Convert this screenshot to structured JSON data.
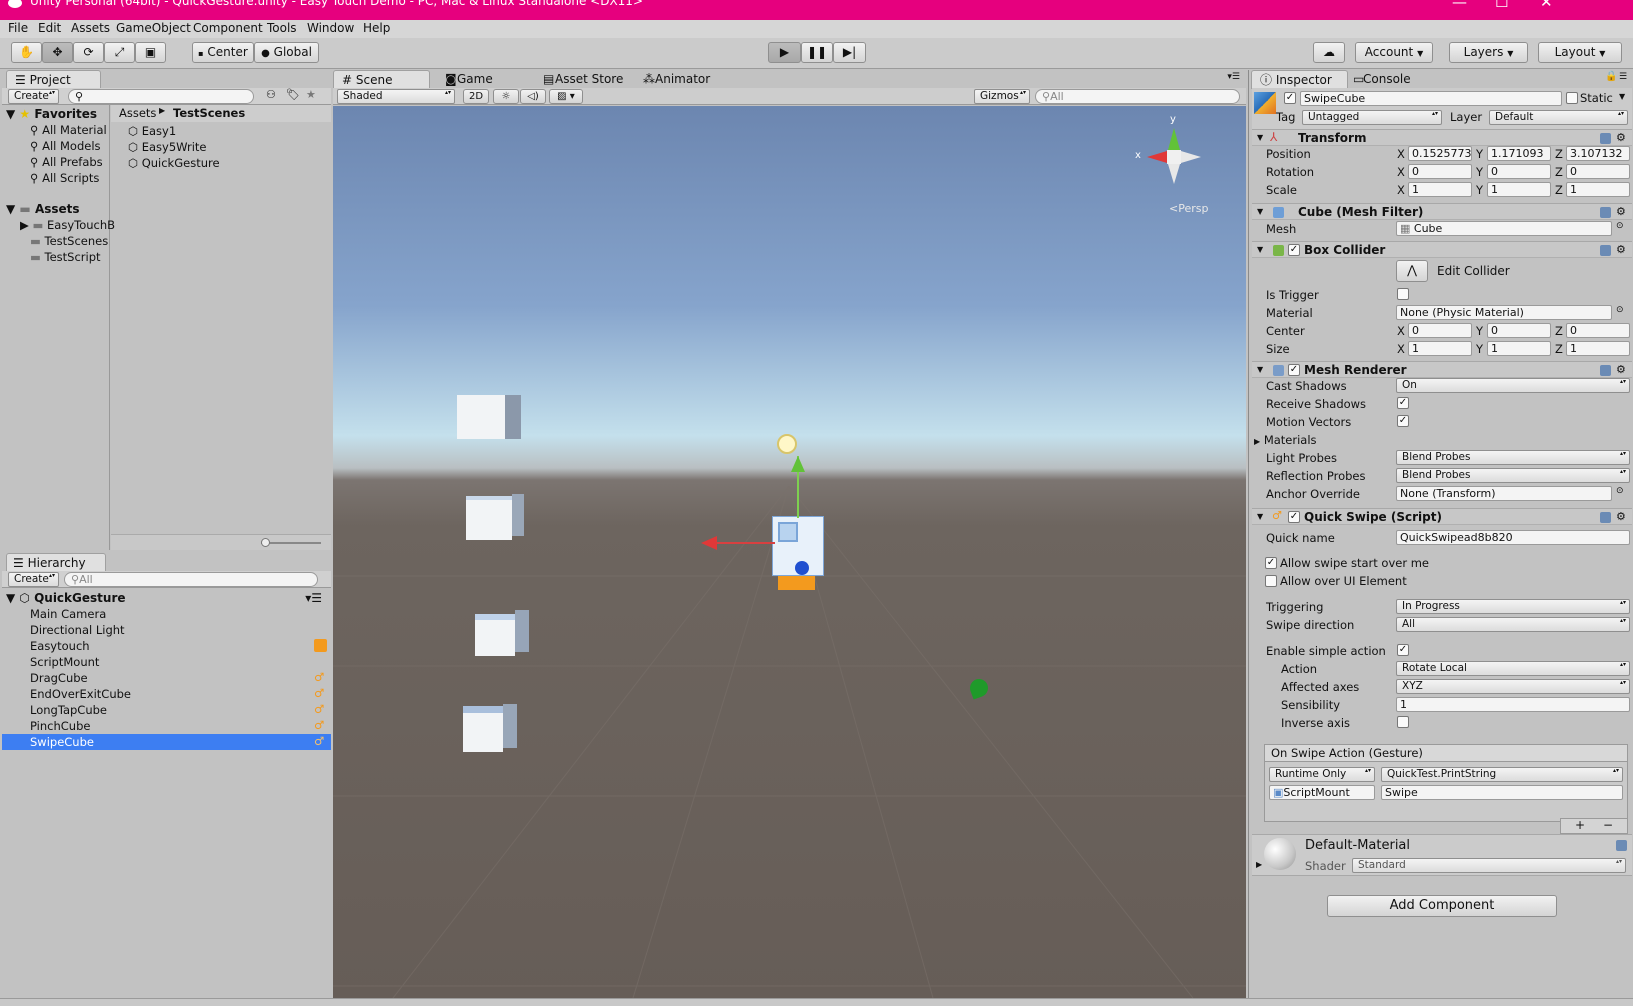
{
  "window": {
    "title": "Unity Personal (64bit) - QuickGesture.unity - Easy Touch Demo - PC, Mac & Linux Standalone <DX11>",
    "minimize": "—",
    "maximize": "☐",
    "close": "✕"
  },
  "menu": [
    "File",
    "Edit",
    "Assets",
    "GameObject",
    "Component",
    "Tools",
    "Window",
    "Help"
  ],
  "toolbar": {
    "pivot": "Center",
    "space": "Global",
    "account": "Account",
    "layers": "Layers",
    "layout": "Layout"
  },
  "project": {
    "tab": "Project",
    "create": "Create",
    "favorites": {
      "label": "Favorites",
      "items": [
        "All Material",
        "All Models",
        "All Prefabs",
        "All Scripts"
      ]
    },
    "assets": {
      "label": "Assets",
      "items": [
        "EasyTouchB",
        "TestScenes",
        "TestScript"
      ]
    },
    "breadcrumb": [
      "Assets",
      "TestScenes"
    ],
    "files": [
      "Easy1",
      "Easy5Write",
      "QuickGesture"
    ]
  },
  "hierarchy": {
    "tab": "Hierarchy",
    "create": "Create",
    "search_placeholder": "All",
    "scene": "QuickGesture",
    "items": [
      "Main Camera",
      "Directional Light",
      "Easytouch",
      "ScriptMount",
      "DragCube",
      "EndOverExitCube",
      "LongTapCube",
      "PinchCube",
      "SwipeCube"
    ],
    "selected": "SwipeCube"
  },
  "scene": {
    "tabs": [
      "Scene",
      "Game",
      "Asset Store",
      "Animator"
    ],
    "shading": "Shaded",
    "mode2d": "2D",
    "gizmos": "Gizmos",
    "search_placeholder": "All",
    "gizmo_x": "x",
    "gizmo_y": "y",
    "persp": "Persp"
  },
  "inspector": {
    "tabs": [
      "Inspector",
      "Console"
    ],
    "object_name": "SwipeCube",
    "static_label": "Static",
    "tag_label": "Tag",
    "tag": "Untagged",
    "layer_label": "Layer",
    "layer": "Default",
    "transform": {
      "title": "Transform",
      "rows": [
        {
          "label": "Position",
          "x": "0.1525773",
          "y": "1.171093",
          "z": "3.107132"
        },
        {
          "label": "Rotation",
          "x": "0",
          "y": "0",
          "z": "0"
        },
        {
          "label": "Scale",
          "x": "1",
          "y": "1",
          "z": "1"
        }
      ]
    },
    "axis_labels": [
      "X",
      "Y",
      "Z"
    ],
    "mesh_filter": {
      "title": "Cube (Mesh Filter)",
      "mesh_label": "Mesh",
      "mesh": "Cube"
    },
    "box_collider": {
      "title": "Box Collider",
      "edit": "Edit Collider",
      "is_trigger": "Is Trigger",
      "material_label": "Material",
      "material": "None (Physic Material)",
      "center_label": "Center",
      "center": [
        "0",
        "0",
        "0"
      ],
      "size_label": "Size",
      "size": [
        "1",
        "1",
        "1"
      ]
    },
    "mesh_renderer": {
      "title": "Mesh Renderer",
      "cast_shadows_label": "Cast Shadows",
      "cast_shadows": "On",
      "receive_shadows": "Receive Shadows",
      "motion_vectors": "Motion Vectors",
      "materials": "Materials",
      "light_probes_label": "Light Probes",
      "light_probes": "Blend Probes",
      "reflection_probes_label": "Reflection Probes",
      "reflection_probes": "Blend Probes",
      "anchor_label": "Anchor Override",
      "anchor": "None (Transform)"
    },
    "quick_swipe": {
      "title": "Quick Swipe (Script)",
      "quick_name_label": "Quick name",
      "quick_name": "QuickSwipead8b820",
      "allow_swipe": "Allow swipe start over me",
      "allow_ui": "Allow over UI Element",
      "triggering_label": "Triggering",
      "triggering": "In Progress",
      "direction_label": "Swipe direction",
      "direction": "All",
      "simple_action": "Enable simple action",
      "action_label": "Action",
      "action": "Rotate Local",
      "axes_label": "Affected axes",
      "axes": "XYZ",
      "sens_label": "Sensibility",
      "sens": "1",
      "inverse_label": "Inverse axis",
      "event_title": "On Swipe Action (Gesture)",
      "runtime": "Runtime Only",
      "function": "QuickTest.PrintString",
      "target": "ScriptMount",
      "arg": "Swipe",
      "plus": "+",
      "minus": "−"
    },
    "material": {
      "name": "Default-Material",
      "shader_label": "Shader",
      "shader": "Standard"
    },
    "add_component": "Add Component"
  }
}
